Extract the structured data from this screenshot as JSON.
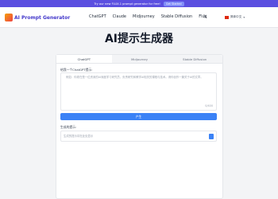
{
  "promo": {
    "text": "Try our new FLUX.1 prompt generator for free!",
    "button": "Get Started"
  },
  "nav": {
    "logo": "AI Prompt Generator",
    "links": [
      "ChatGPT",
      "Claude",
      "Midjourney",
      "Stable Diffusion",
      "Flux"
    ],
    "x_icon": "𝕏",
    "language": "简体中文"
  },
  "page": {
    "title": "AI提示生成器"
  },
  "tabs": [
    "ChatGPT",
    "Midjourney",
    "Stable Diffusion"
  ],
  "form": {
    "input_label": "给我一个ChatGPT提示:",
    "placeholder": "例如：你现在是一位资深的AI深度学习研究员，负责研究和教学AI相关的课程与技术。请你创作一篇关于AI的文章。",
    "counter": "0/400",
    "generate_button": "产生",
    "output_label": "生成的提示:",
    "output_placeholder": "生成的提示将在此处显示"
  },
  "colors": {
    "brand": "#4338ca",
    "primary": "#3b82f6",
    "promo_bg": "#5b4fe0"
  },
  "icons": {
    "logo": "logo-icon",
    "x": "x-icon",
    "flag": "flag-icon",
    "chevron": "chevron-down-icon",
    "copy": "copy-icon"
  }
}
